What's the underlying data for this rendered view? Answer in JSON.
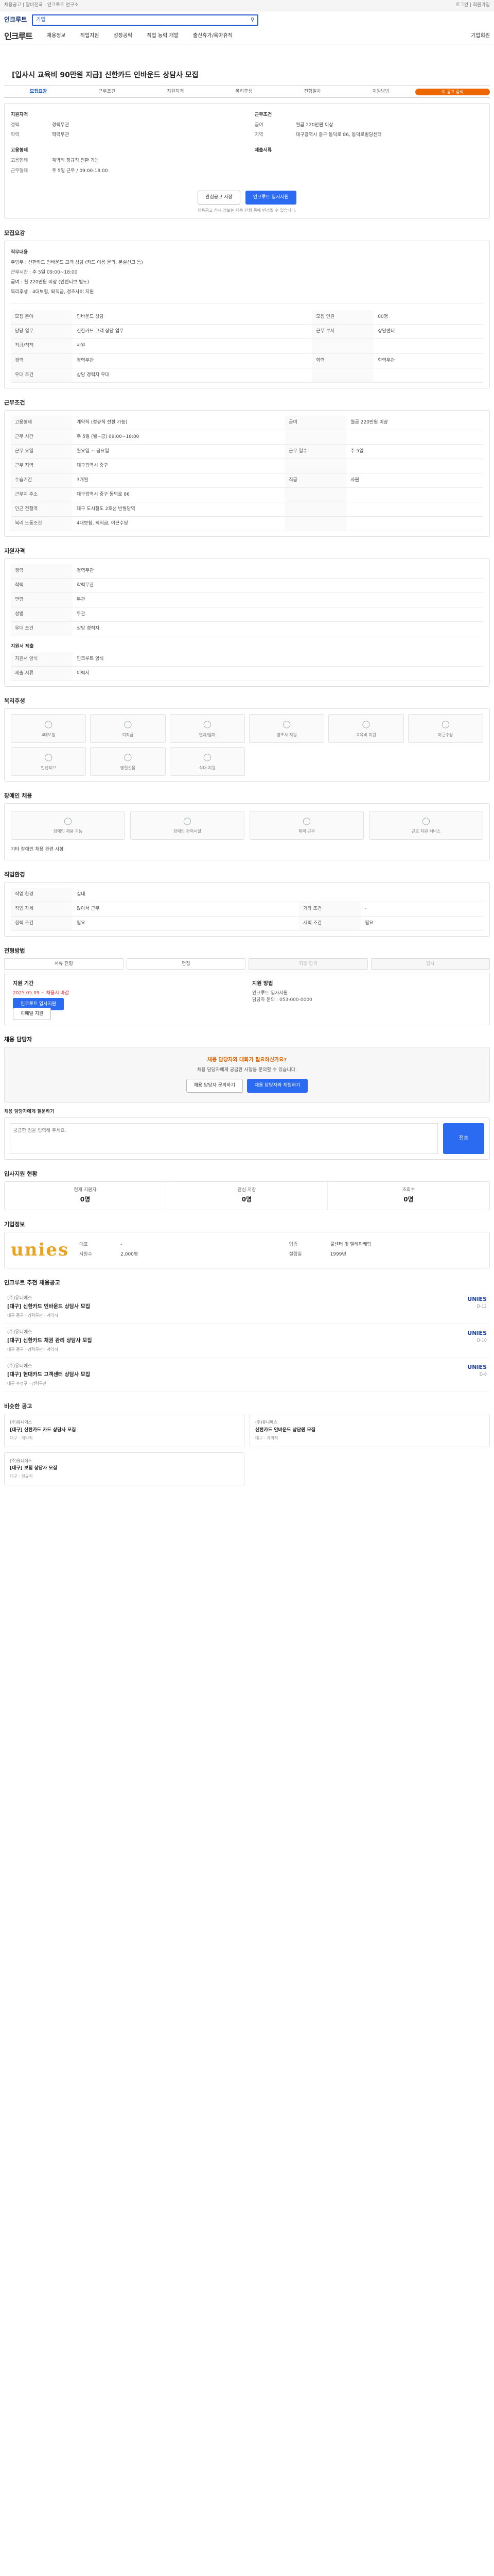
{
  "topbar": {
    "left": "채용공고 | 알바천국 | 인크루트 연구소",
    "right": "로그인 | 회원가입"
  },
  "search": {
    "logo": "인크루트",
    "placeholder": "기업"
  },
  "nav": {
    "brand": "인크루트",
    "items": [
      "채용정보",
      "직업지원",
      "성장공략",
      "직업 능력 개발",
      "출산휴가/육아휴직"
    ],
    "tail": "기업회원"
  },
  "title": "[입사시 교육비 90만원 지급] 신한카드 인바운드 상담사 모집",
  "subtabs": [
    "모집요강",
    "근무조건",
    "지원자격",
    "복리후생",
    "전형절차",
    "지원방법"
  ],
  "badge": "이 공고 검색",
  "summary": {
    "left_head": "지원자격",
    "left": [
      {
        "k": "경력",
        "v": "경력무관"
      },
      {
        "k": "학력",
        "v": "학력무관"
      }
    ],
    "right_head": "근무조건",
    "right": [
      {
        "k": "급여",
        "v": "월급 220만원 이상"
      },
      {
        "k": "지역",
        "v": "대구광역시 중구 동덕로 86, 동덕로빌딩센터"
      }
    ],
    "mid_head": "고용형태",
    "mid_head2": "제출서류",
    "mid": [
      {
        "k": "고용형태",
        "v": "계약직 정규직 전환 가능"
      },
      {
        "k": "근무형태",
        "v": "주 5일 근무 / 09:00-18:00"
      }
    ]
  },
  "actions": {
    "scrap": "관심공고 저장",
    "apply": "인크루트 입사지원"
  },
  "notice": "채용공고 상세 정보는 채용 진행 중에 변경될 수 있습니다.",
  "recruit": {
    "title": "모집요강",
    "head": "직무내용",
    "lines": [
      "주업무 : 신한카드 인바운드 고객 상담 (카드 이용 문의, 분실신고 등)",
      "근무시간 : 주 5일 09:00~18:00",
      "급여 : 월 220만원 이상 (인센티브 별도)",
      "복리후생 : 4대보험, 퇴직금, 경조사비 지원"
    ],
    "rows": [
      {
        "k": "모집 분야",
        "v": "인바운드 상담",
        "k2": "모집 인원",
        "v2": "00명"
      },
      {
        "k": "담당 업무",
        "v": "신한카드 고객 상담 업무",
        "k2": "근무 부서",
        "v2": "상담센터"
      },
      {
        "k": "직급/직책",
        "v": "사원",
        "k2": "",
        "v2": ""
      },
      {
        "k": "경력",
        "v": "경력무관",
        "k2": "학력",
        "v2": "학력무관"
      },
      {
        "k": "우대 조건",
        "v": "상담 경력자 우대",
        "k2": "",
        "v2": ""
      }
    ]
  },
  "conditions": {
    "title": "근무조건",
    "rows": [
      {
        "k": "고용형태",
        "v": "계약직 (정규직 전환 가능)",
        "k2": "급여",
        "v2": "월급 220만원 이상"
      },
      {
        "k": "근무 시간",
        "v": "주 5일 (월~금) 09:00~18:00",
        "k2": "",
        "v2": ""
      },
      {
        "k": "근무 요일",
        "v": "월요일 ~ 금요일",
        "k2": "근무 일수",
        "v2": "주 5일"
      },
      {
        "k": "근무 지역",
        "v": "대구광역시 중구",
        "k2": "",
        "v2": ""
      },
      {
        "k": "수습기간",
        "v": "3개월",
        "k2": "직급",
        "v2": "사원"
      },
      {
        "k": "근무지 주소",
        "v": "대구광역시 중구 동덕로 86",
        "k2": "",
        "v2": ""
      },
      {
        "k": "인근 전철역",
        "v": "대구 도시철도 2호선 반월당역",
        "k2": "",
        "v2": ""
      },
      {
        "k": "복리 노동조건",
        "v": "4대보험, 퇴직금, 야근수당",
        "k2": "",
        "v2": ""
      }
    ]
  },
  "qualify": {
    "title": "지원자격",
    "rows": [
      {
        "k": "경력",
        "v": "경력무관"
      },
      {
        "k": "학력",
        "v": "학력무관"
      },
      {
        "k": "연령",
        "v": "무관"
      },
      {
        "k": "성별",
        "v": "무관"
      },
      {
        "k": "우대 조건",
        "v": "상담 경력자"
      }
    ]
  },
  "process": {
    "title": "지원서 제출",
    "rows": [
      {
        "k": "지원서 양식",
        "v": "인크루트 양식"
      },
      {
        "k": "제출 서류",
        "v": "이력서"
      }
    ]
  },
  "benefits": {
    "title": "복리후생",
    "items": [
      "4대보험",
      "퇴직금",
      "연차/월차",
      "경조사 지원",
      "교육비 지원",
      "야근수당",
      "인센티브",
      "명절선물",
      "식대 지원"
    ]
  },
  "specs": {
    "title": "장애인 채용",
    "items": [
      "장애인 채용 가능",
      "장애인 편의시설",
      "재택 근무",
      "근로 지원 서비스"
    ],
    "note": "기타 장애인 채용 관련 사항"
  },
  "workinfo": {
    "title": "직업환경",
    "rows": [
      {
        "k": "작업 환경",
        "v": "실내"
      },
      {
        "k": "작업 자세",
        "v": "앉아서 근무",
        "k2": "기타 조건",
        "v2": "-"
      },
      {
        "k": "청력 조건",
        "v": "필요",
        "k2": "시력 조건",
        "v2": "필요"
      }
    ]
  },
  "steps": {
    "title": "전형방법",
    "items": [
      "서류 전형",
      "면접",
      "최종 합격",
      "입사"
    ]
  },
  "apply": {
    "title": "지원 기간",
    "period": "2025.05.09 ~ 채용시 마감",
    "apply_title": "지원 방법",
    "method": "인크루트 입사지원",
    "contact": "담당자 문의 : 053-000-0000",
    "btn": "인크루트 입사지원",
    "btn2": "이메일 지원"
  },
  "inquiry": {
    "title": "채용 담당자",
    "box_head": "채용 담당자와 대화가 필요하신가요?",
    "box_text": "채용 담당자에게 궁금한 사항을 문의할 수 있습니다.",
    "b1": "채용 담당자 문의하기",
    "b2": "채용 담당자와 채팅하기",
    "q_label": "채용 담당자에게 질문하기",
    "q_placeholder": "궁금한 점을 입력해 주세요.",
    "send": "전송"
  },
  "stats": {
    "title": "입사지원 현황",
    "items": [
      {
        "k": "현재 지원자",
        "v": "0명"
      },
      {
        "k": "관심 저장",
        "v": "0명"
      },
      {
        "k": "조회수",
        "v": "0명"
      }
    ]
  },
  "company": {
    "title": "기업정보",
    "logo": "unies",
    "rows": [
      {
        "k": "대표",
        "v": "-"
      },
      {
        "k": "업종",
        "v": "콜센터 및 텔레마케팅"
      },
      {
        "k": "사원수",
        "v": "2,000명"
      },
      {
        "k": "설립일",
        "v": "1999년"
      }
    ]
  },
  "jobs": {
    "title": "인크루트 추천 채용공고",
    "items": [
      {
        "nm": "(주)유니에스",
        "tt": "[대구] 신한카드 인바운드 상담사 모집",
        "meta": "대구 중구 · 경력무관 · 계약직",
        "logo": "UNIES",
        "d": "D-12"
      },
      {
        "nm": "(주)유니에스",
        "tt": "[대구] 신한카드 채권 관리 상담사 모집",
        "meta": "대구 중구 · 경력무관 · 계약직",
        "logo": "UNIES",
        "d": "D-10"
      },
      {
        "nm": "(주)유니에스",
        "tt": "[대구] 현대카드 고객센터 상담사 모집",
        "meta": "대구 수성구 · 경력무관",
        "logo": "UNIES",
        "d": "D-8"
      }
    ]
  },
  "similar": {
    "title": "비슷한 공고",
    "items": [
      {
        "n": "(주)유니에스",
        "t": "[대구] 신한카드 카드 상담사 모집",
        "m": "대구 · 계약직"
      },
      {
        "n": "(주)유니에스",
        "t": "신한카드 인바운드 상담원 모집",
        "m": "대구 · 계약직"
      },
      {
        "n": "(주)유니에스",
        "t": "[대구] 보험 상담사 모집",
        "m": "대구 · 정규직"
      }
    ]
  }
}
